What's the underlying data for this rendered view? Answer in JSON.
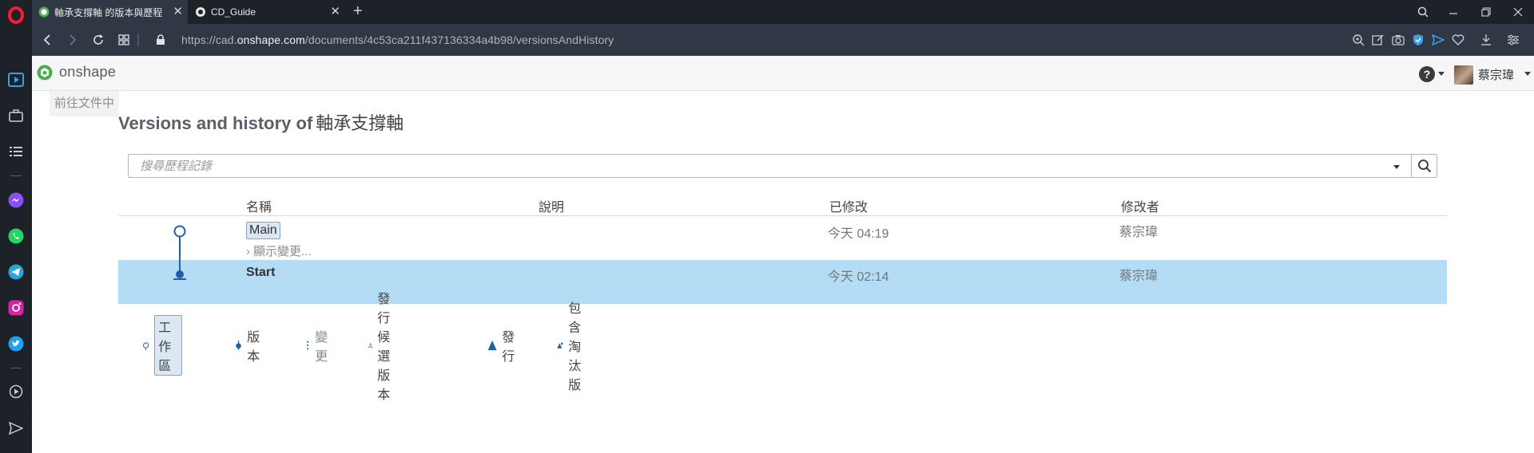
{
  "browser": {
    "tabs": [
      {
        "title": "軸承支撐軸 的版本與歷程",
        "active": true
      },
      {
        "title": "CD_Guide",
        "active": false
      }
    ],
    "url": {
      "prefix": "https://cad.",
      "host": "onshape.com",
      "path": "/documents/4c53ca211f437136334a4b98/versionsAndHistory"
    }
  },
  "onshape": {
    "brand": "onshape",
    "help_label": "?",
    "user_name": "蔡宗瑋",
    "back_to_document": "前往文件中"
  },
  "page": {
    "title_prefix": "Versions and history of",
    "document_name": "軸承支撐軸",
    "search_placeholder": "搜尋歷程記錄"
  },
  "table": {
    "headers": {
      "name": "名稱",
      "description": "說明",
      "modified": "已修改",
      "modified_by": "修改者"
    },
    "rows": [
      {
        "name": "Main",
        "show_changes": "顯示變更...",
        "modified": "今天 04:19",
        "modified_by": "蔡宗瑋",
        "kind": "workspace",
        "selected": false
      },
      {
        "name": "Start",
        "modified": "今天 02:14",
        "modified_by": "蔡宗瑋",
        "kind": "version",
        "selected": true
      }
    ]
  },
  "legend": {
    "workspace": "工作區",
    "version": "版本",
    "change": "變更",
    "release_candidate": "發行候選版本",
    "release": "發行",
    "obsolete": "包含淘汰版"
  },
  "colors": {
    "accent": "#1f5fa8",
    "selected_row": "#b4dcf5",
    "opera_red": "#ff1b2d",
    "onshape_green": "#4cae4f"
  }
}
